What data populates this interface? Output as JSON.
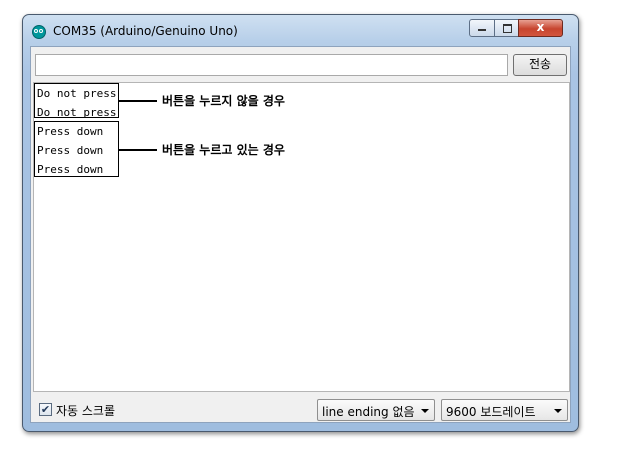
{
  "window": {
    "title": "COM35 (Arduino/Genuino Uno)",
    "close_glyph": "x",
    "icon": "arduino-icon"
  },
  "send": {
    "input_value": "",
    "button_label": "전송"
  },
  "output": {
    "group1": [
      "Do not press",
      "Do not press"
    ],
    "group2": [
      "Press down",
      "Press down",
      "Press down"
    ]
  },
  "annotations": {
    "not_pressed": "버튼을 누르지 않을 경우",
    "pressed": "버튼을 누르고 있는 경우"
  },
  "footer": {
    "autoscroll_label": "자동 스크롤",
    "autoscroll_checked": true,
    "line_ending": "line ending 없음",
    "baud_rate": "9600 보드레이트"
  }
}
